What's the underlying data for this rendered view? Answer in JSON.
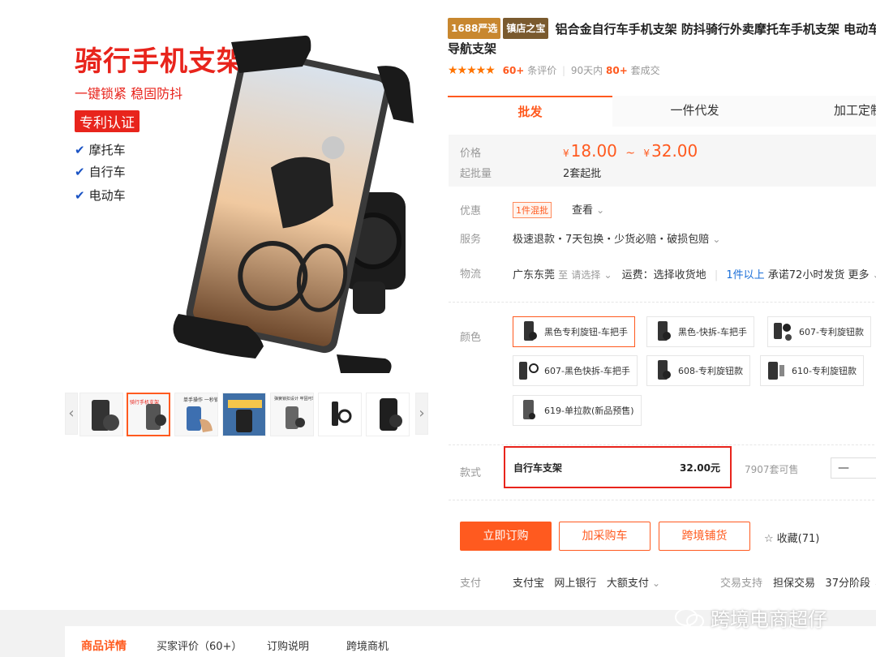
{
  "product_image": {
    "headline": "骑行手机支架",
    "subline": "一键锁紧  稳固防抖",
    "badge": "专利认证",
    "features": [
      "摩托车",
      "自行车",
      "电动车"
    ]
  },
  "thumbnails": {
    "count": 7,
    "active_index": 1,
    "captions": [
      "",
      "",
      "单手操作 一秒锁定",
      "",
      "弹簧锁扣设计 牢固可靠",
      "",
      ""
    ]
  },
  "title": {
    "tags": [
      "1688严选",
      "镇店之宝"
    ],
    "text": "铝合金自行车手机支架 防抖骑行外卖摩托车手机支架 电动车导航支架"
  },
  "rating": {
    "stars": "★★★★★",
    "review_count": "60+",
    "review_label": "条评价",
    "period_label": "90天内",
    "deal_count": "80+",
    "deal_label": "套成交"
  },
  "tabs": [
    "批发",
    "一件代发",
    "加工定制"
  ],
  "price": {
    "label": "价格",
    "currency": "¥",
    "low": "18.00",
    "separator": "~",
    "high": "32.00",
    "moq_label": "起批量",
    "moq_value": "2套起批"
  },
  "offers": {
    "label": "优惠",
    "badge": "1件混批",
    "link": "查看"
  },
  "service": {
    "label": "服务",
    "text": "极速退款・7天包换・少货必赔・破损包赔"
  },
  "logistics": {
    "label": "物流",
    "origin": "广东东莞",
    "to": "至",
    "select": "请选择",
    "freight": "运费：选择收货地",
    "min_order": "1件以上",
    "promise": "承诺72小时发货",
    "more": "更多"
  },
  "colors": {
    "label": "颜色",
    "options": [
      "黑色专利旋钮-车把手",
      "黑色-快拆-车把手",
      "607-专利旋钮款",
      "607-黑色快拆-车把手",
      "608-专利旋钮款",
      "610-专利旋钮款",
      "619-单拉款(新品预售)"
    ]
  },
  "style": {
    "label": "款式",
    "name": "自行车支架",
    "price": "32.00元",
    "stock": "7907套可售",
    "qty_minus": "—"
  },
  "actions": {
    "buy": "立即订购",
    "cart": "加采购车",
    "cross_border": "跨境铺货",
    "favorite": "收藏(71)"
  },
  "payment": {
    "label": "支付",
    "methods": [
      "支付宝",
      "网上银行",
      "大额支付"
    ],
    "trade_label": "交易支持",
    "guarantee": "担保交易",
    "installment": "37分阶段"
  },
  "footer_tabs": [
    "商品详情",
    "买家评价（60+）",
    "订购说明",
    "跨境商机"
  ],
  "watermark": "跨境电商超仔",
  "colors_theme": {
    "accent": "#ff5a1f",
    "red": "#e8241c",
    "blue": "#1a6ed8"
  }
}
